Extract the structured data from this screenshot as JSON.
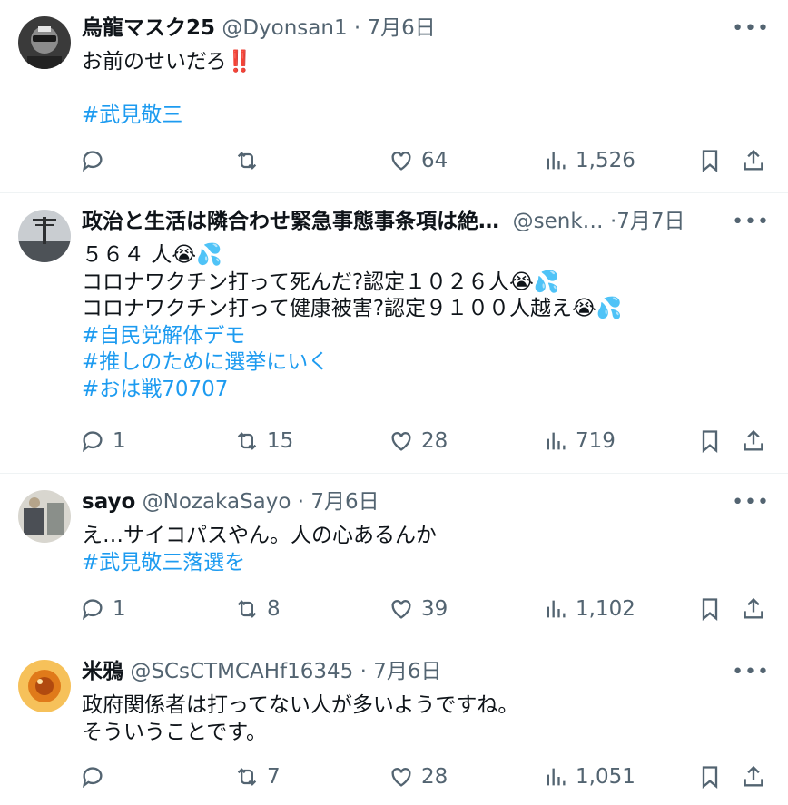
{
  "tweets": [
    {
      "name": "烏龍マスク25",
      "handle": "@Dyonsan1",
      "sep": "·",
      "date": "7月6日",
      "lines": [
        "お前のせいだろ‼️",
        "",
        "#武見敬三"
      ],
      "line_kinds": [
        "text",
        "blank",
        "hashtag"
      ],
      "replies": "",
      "retweets": "",
      "likes": "64",
      "views": "1,526",
      "avatar_colors": [
        "#2f2f2f",
        "#9aa0a6"
      ]
    },
    {
      "name": "政治と生活は隣合わせ緊急事態事条項は絶…",
      "handle": "@senk…",
      "sep": "·",
      "date": "7月7日",
      "lines": [
        "５６４ 人😭💦",
        "コロナワクチン打って死んだ?認定１０２６人😭💦",
        "コロナワクチン打って健康被害?認定９１００人越え😭💦",
        "#自民党解体デモ",
        "#推しのために選挙にいく",
        "#おは戦70707"
      ],
      "line_kinds": [
        "text",
        "text",
        "text",
        "hashtag",
        "hashtag",
        "hashtag"
      ],
      "replies": "1",
      "retweets": "15",
      "likes": "28",
      "views": "719",
      "avatar_colors": [
        "#6b7075",
        "#c9cdd1"
      ]
    },
    {
      "name": "sayo",
      "handle": "@NozakaSayo",
      "sep": "·",
      "date": "7月6日",
      "lines": [
        "え…サイコパスやん。人の心あるんか",
        "#武見敬三落選を"
      ],
      "line_kinds": [
        "text",
        "hashtag"
      ],
      "replies": "1",
      "retweets": "8",
      "likes": "39",
      "views": "1,102",
      "avatar_colors": [
        "#8a8f8a",
        "#d8d6cf"
      ]
    },
    {
      "name": "米鴉",
      "handle": "@SCsCTMCAHf16345",
      "sep": "·",
      "date": "7月6日",
      "lines": [
        "政府関係者は打ってない人が多いようですね。",
        "そういうことです。"
      ],
      "line_kinds": [
        "text",
        "text"
      ],
      "replies": "",
      "retweets": "7",
      "likes": "28",
      "views": "1,051",
      "avatar_colors": [
        "#e07a1a",
        "#f6c15a"
      ]
    }
  ],
  "more_label": "•••"
}
